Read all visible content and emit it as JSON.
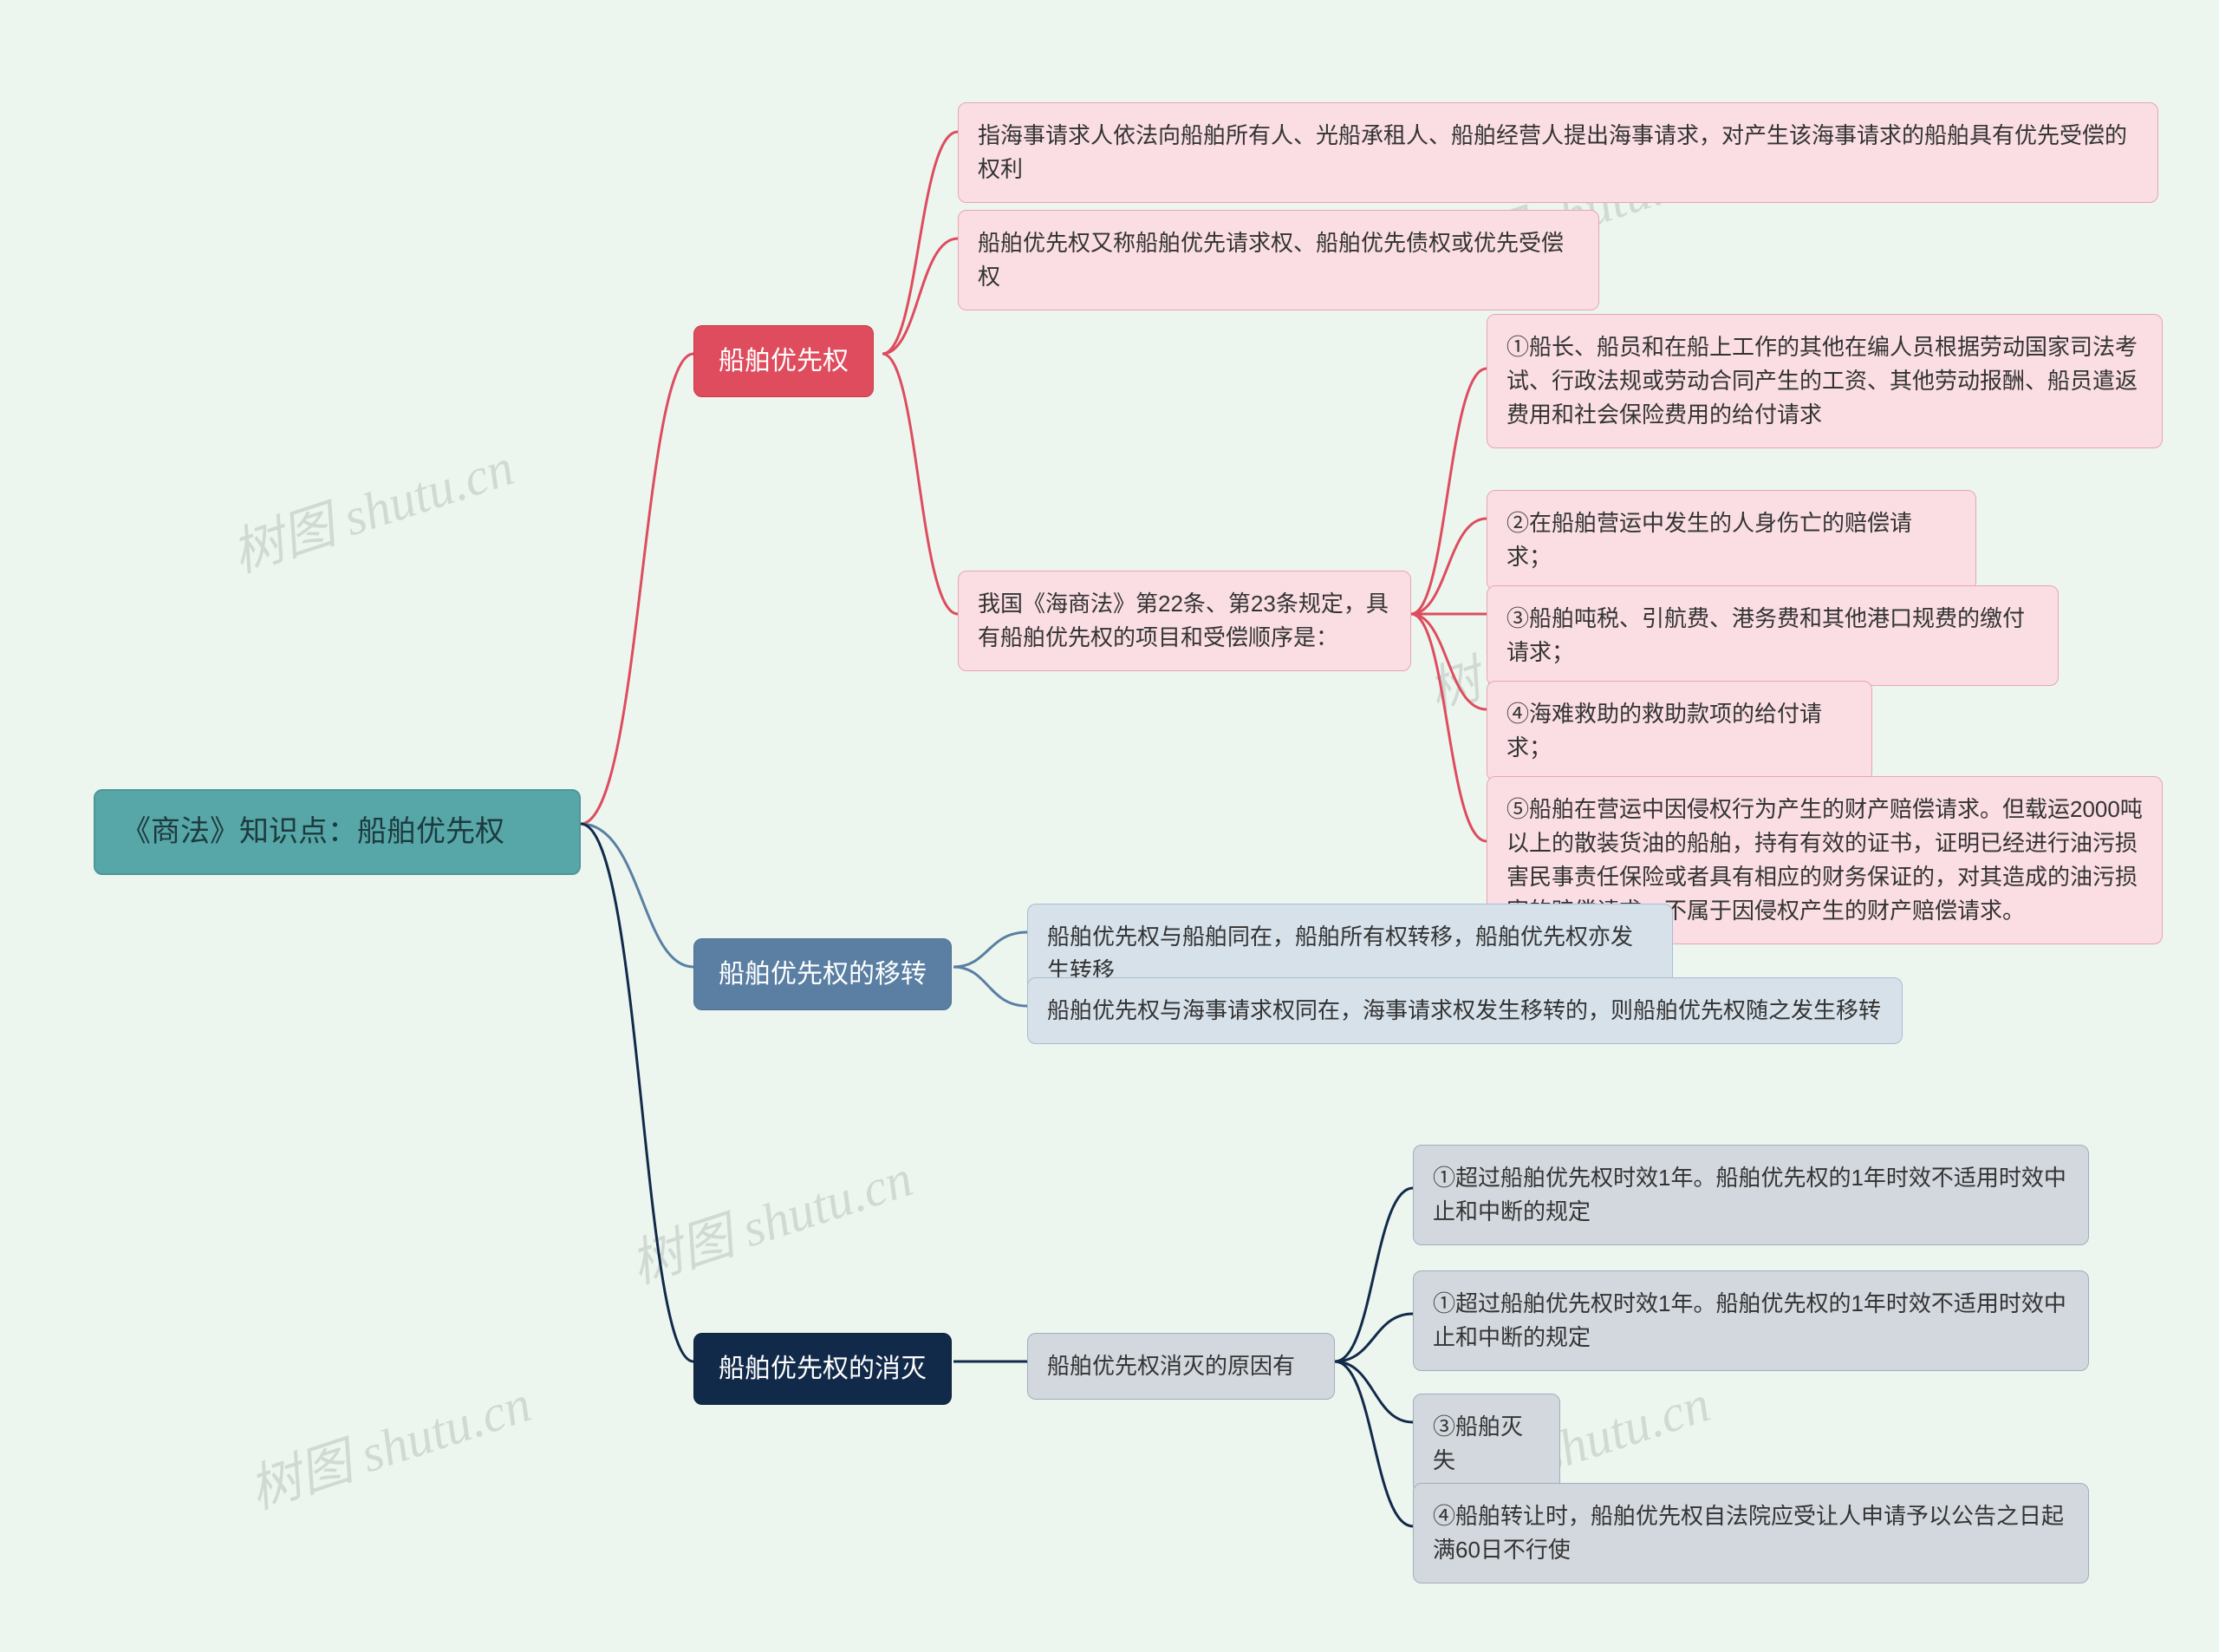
{
  "root": "《商法》知识点：船舶优先权",
  "branch1": {
    "title": "船舶优先权",
    "c1": "指海事请求人依法向船舶所有人、光船承租人、船舶经营人提出海事请求，对产生该海事请求的船舶具有优先受偿的权利",
    "c2": "船舶优先权又称船舶优先请求权、船舶优先债权或优先受偿权",
    "c3": "我国《海商法》第22条、第23条规定，具有船舶优先权的项目和受偿顺序是：",
    "c3_1": "①船长、船员和在船上工作的其他在编人员根据劳动国家司法考试、行政法规或劳动合同产生的工资、其他劳动报酬、船员遣返费用和社会保险费用的给付请求",
    "c3_2": "②在船舶营运中发生的人身伤亡的赔偿请求；",
    "c3_3": "③船舶吨税、引航费、港务费和其他港口规费的缴付请求；",
    "c3_4": "④海难救助的救助款项的给付请求；",
    "c3_5": "⑤船舶在营运中因侵权行为产生的财产赔偿请求。但载运2000吨以上的散装货油的船舶，持有有效的证书，证明已经进行油污损害民事责任保险或者具有相应的财务保证的，对其造成的油污损害的赔偿请求，不属于因侵权产生的财产赔偿请求。"
  },
  "branch2": {
    "title": "船舶优先权的移转",
    "c1": "船舶优先权与船舶同在，船舶所有权转移，船舶优先权亦发生转移",
    "c2": "船舶优先权与海事请求权同在，海事请求权发生移转的，则船舶优先权随之发生移转"
  },
  "branch3": {
    "title": "船舶优先权的消灭",
    "c1": "船舶优先权消灭的原因有",
    "c1_1": "①超过船舶优先权时效1年。船舶优先权的1年时效不适用时效中止和中断的规定",
    "c1_2": "①超过船舶优先权时效1年。船舶优先权的1年时效不适用时效中止和中断的规定",
    "c1_3": "③船舶灭失",
    "c1_4": "④船舶转让时，船舶优先权自法院应受让人申请予以公告之日起满60日不行使"
  },
  "watermark": "树图 shutu.cn"
}
